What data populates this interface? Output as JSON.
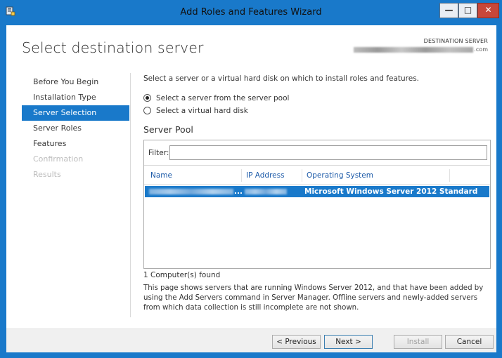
{
  "window": {
    "title": "Add Roles and Features Wizard",
    "minimize_glyph": "—",
    "maximize_glyph": "□",
    "close_glyph": "✕"
  },
  "page": {
    "title": "Select destination server",
    "destination_label": "DESTINATION SERVER",
    "destination_suffix": ".com"
  },
  "nav": {
    "items": [
      {
        "label": "Before You Begin",
        "state": "normal"
      },
      {
        "label": "Installation Type",
        "state": "normal"
      },
      {
        "label": "Server Selection",
        "state": "selected"
      },
      {
        "label": "Server Roles",
        "state": "normal"
      },
      {
        "label": "Features",
        "state": "normal"
      },
      {
        "label": "Confirmation",
        "state": "disabled"
      },
      {
        "label": "Results",
        "state": "disabled"
      }
    ]
  },
  "content": {
    "intro": "Select a server or a virtual hard disk on which to install roles and features.",
    "option_pool": "Select a server from the server pool",
    "option_vhd": "Select a virtual hard disk",
    "pool_label": "Server Pool",
    "filter_label": "Filter:",
    "filter_value": "",
    "columns": [
      "Name",
      "IP Address",
      "Operating System"
    ],
    "rows": [
      {
        "name_suffix": "...",
        "os": "Microsoft Windows Server 2012 Standard"
      }
    ],
    "found": "1 Computer(s) found",
    "note": "This page shows servers that are running Windows Server 2012, and that have been added by using the Add Servers command in Server Manager. Offline servers and newly-added servers from which data collection is still incomplete are not shown."
  },
  "buttons": {
    "previous": "< Previous",
    "next": "Next >",
    "install": "Install",
    "cancel": "Cancel"
  },
  "colors": {
    "accent": "#1979ca",
    "close": "#c7473a"
  }
}
